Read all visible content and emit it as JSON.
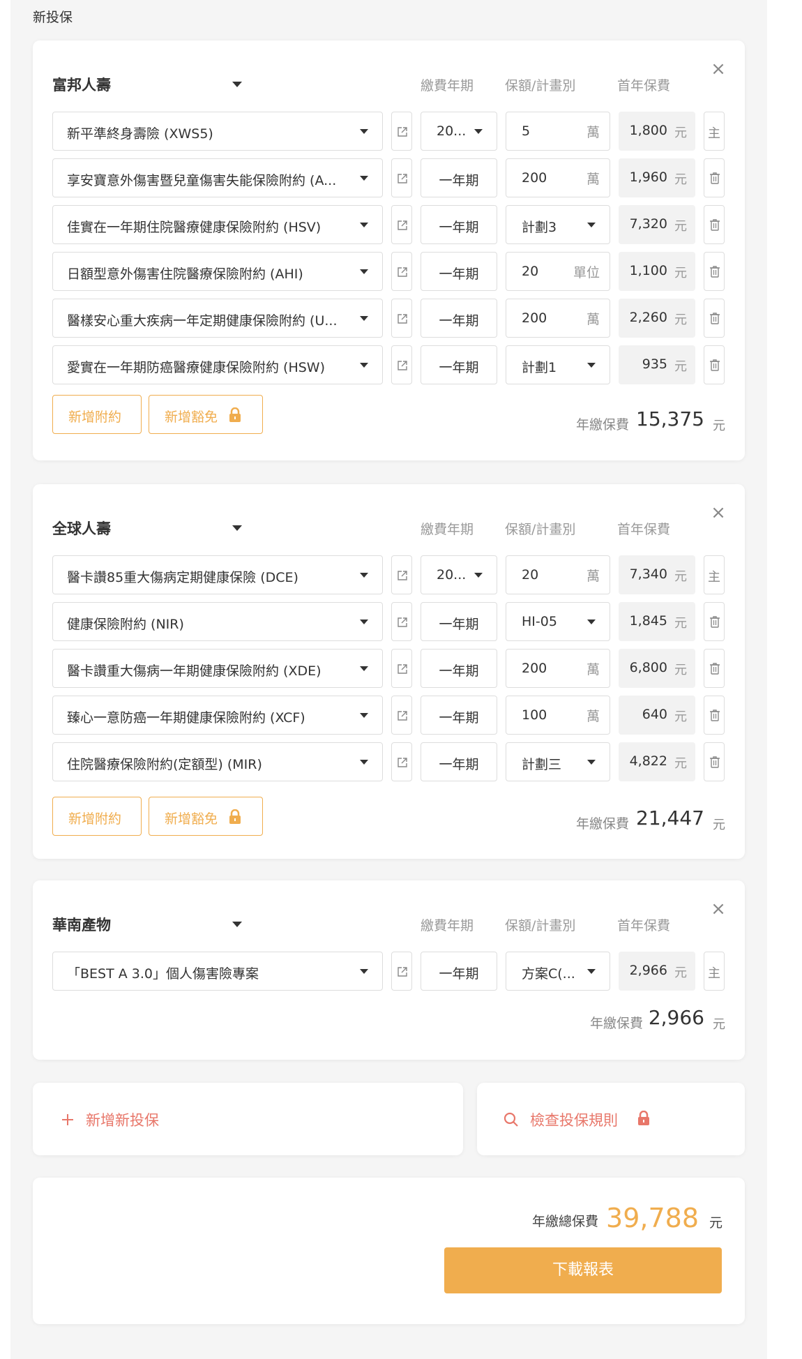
{
  "page_title": "新投保",
  "columns": {
    "years": "繳費年期",
    "amount": "保額/計畫別",
    "premium": "首年保費"
  },
  "currency_unit": "元",
  "main_badge": "主",
  "add_rider_label": "新增附約",
  "add_waiver_label": "新增豁免",
  "annual_label": "年繳保費",
  "policies": [
    {
      "company": "富邦人壽",
      "rows": [
        {
          "product": "新平準終身壽險 (XWS5)",
          "years": "20...",
          "years_dd": true,
          "amount": "5",
          "unit": "萬",
          "amount_dd": false,
          "premium": "1,800",
          "main": true
        },
        {
          "product": "享安寶意外傷害暨兒童傷害失能保險附約 (A...",
          "years": "一年期",
          "years_dd": false,
          "amount": "200",
          "unit": "萬",
          "amount_dd": false,
          "premium": "1,960",
          "main": false
        },
        {
          "product": "佳實在一年期住院醫療健康保險附約 (HSV)",
          "years": "一年期",
          "years_dd": false,
          "amount": "計劃3",
          "unit": "",
          "amount_dd": true,
          "premium": "7,320",
          "main": false
        },
        {
          "product": "日額型意外傷害住院醫療保險附約 (AHI)",
          "years": "一年期",
          "years_dd": false,
          "amount": "20",
          "unit": "單位",
          "amount_dd": false,
          "premium": "1,100",
          "main": false
        },
        {
          "product": "醫樣安心重大疾病一年定期健康保險附約 (U...",
          "years": "一年期",
          "years_dd": false,
          "amount": "200",
          "unit": "萬",
          "amount_dd": false,
          "premium": "2,260",
          "main": false
        },
        {
          "product": "愛實在一年期防癌醫療健康保險附約 (HSW)",
          "years": "一年期",
          "years_dd": false,
          "amount": "計劃1",
          "unit": "",
          "amount_dd": true,
          "premium": "935",
          "main": false
        }
      ],
      "total": "15,375"
    },
    {
      "company": "全球人壽",
      "rows": [
        {
          "product": "醫卡讚85重大傷病定期健康保險 (DCE)",
          "years": "20...",
          "years_dd": true,
          "amount": "20",
          "unit": "萬",
          "amount_dd": false,
          "premium": "7,340",
          "main": true
        },
        {
          "product": "健康保險附約 (NIR)",
          "years": "一年期",
          "years_dd": false,
          "amount": "HI-05",
          "unit": "",
          "amount_dd": true,
          "premium": "1,845",
          "main": false
        },
        {
          "product": "醫卡讚重大傷病一年期健康保險附約 (XDE)",
          "years": "一年期",
          "years_dd": false,
          "amount": "200",
          "unit": "萬",
          "amount_dd": false,
          "premium": "6,800",
          "main": false
        },
        {
          "product": "臻心一意防癌一年期健康保險附約 (XCF)",
          "years": "一年期",
          "years_dd": false,
          "amount": "100",
          "unit": "萬",
          "amount_dd": false,
          "premium": "640",
          "main": false
        },
        {
          "product": "住院醫療保險附約(定額型) (MIR)",
          "years": "一年期",
          "years_dd": false,
          "amount": "計劃三",
          "unit": "",
          "amount_dd": true,
          "premium": "4,822",
          "main": false
        }
      ],
      "total": "21,447"
    },
    {
      "company": "華南產物",
      "rows": [
        {
          "product": "「BEST A 3.0」個人傷害險專案",
          "years": "一年期",
          "years_dd": false,
          "amount": "方案C(...",
          "unit": "",
          "amount_dd": true,
          "premium": "2,966",
          "main": true
        }
      ],
      "total": "2,966"
    }
  ],
  "add_new_policy": "新增新投保",
  "check_rules": "檢查投保規則",
  "grand_total_label": "年繳總保費",
  "grand_total": "39,788",
  "download_label": "下載報表",
  "colors": {
    "accent": "#f0ad4e",
    "danger_text": "#e8776a",
    "page_bg": "#f5f5f5"
  },
  "icons": [
    "close-icon",
    "caret-down-icon",
    "external-link-icon",
    "trash-icon",
    "lock-icon",
    "plus-icon",
    "search-icon"
  ]
}
